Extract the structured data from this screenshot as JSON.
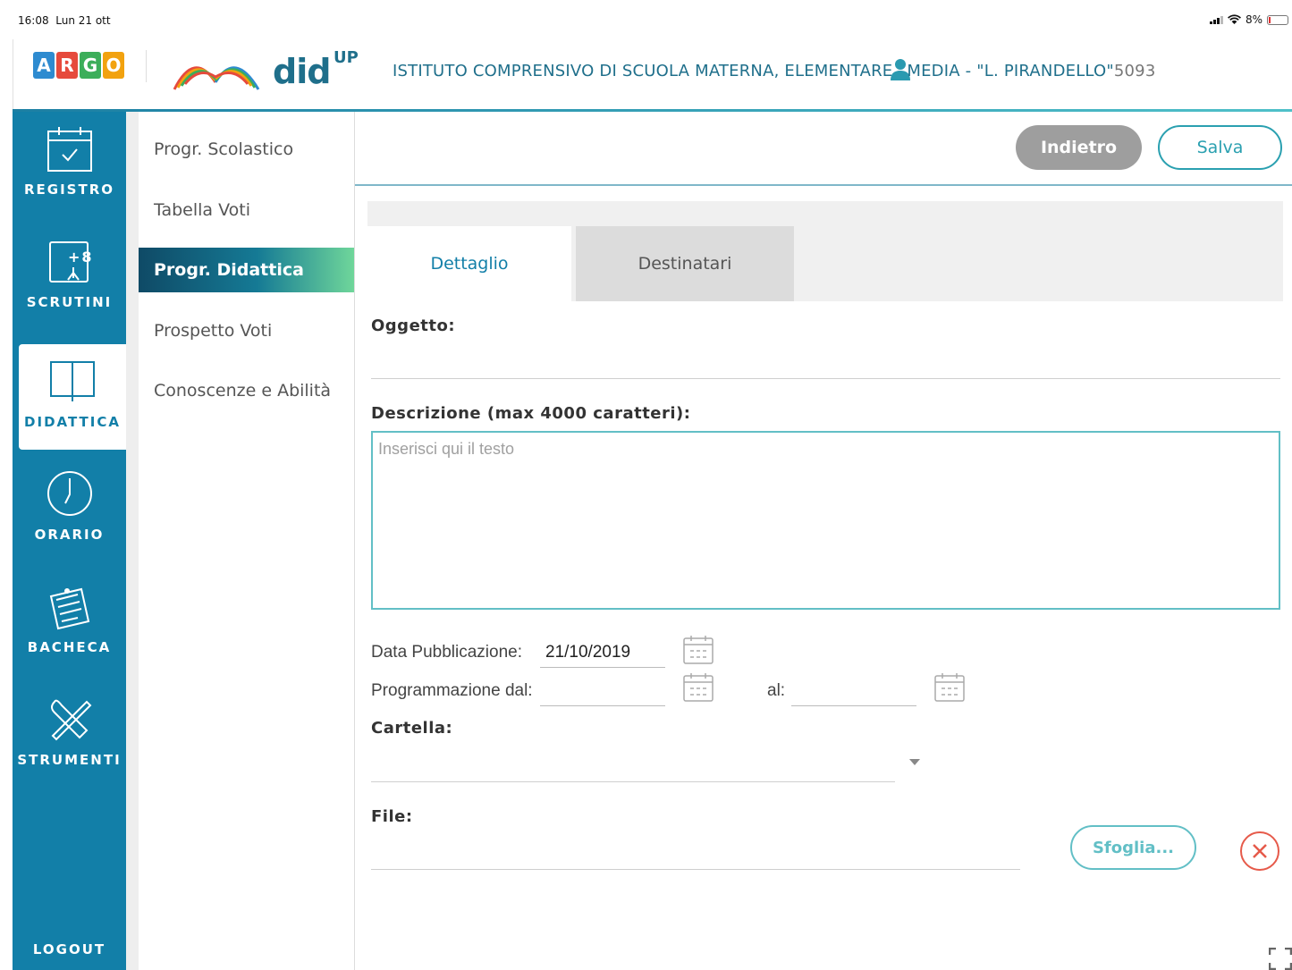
{
  "status": {
    "time": "16:08",
    "date": "Lun 21 ott",
    "battery": "8%"
  },
  "header": {
    "argo_letters": [
      "A",
      "R",
      "G",
      "O"
    ],
    "argo_colors": [
      "#2e8bd0",
      "#e64a3c",
      "#3cae5a",
      "#f2a20f"
    ],
    "app_name": "did",
    "app_sup": "UP",
    "school_before": "ISTITUTO COMPRENSIVO DI SCUOLA MATERNA, ELEMENTARE",
    "school_after": "MEDIA - \"L. PIRANDELLO\"",
    "school_code": "5093"
  },
  "nav": {
    "items": [
      {
        "label": "REGISTRO",
        "icon": "calendar-check-icon"
      },
      {
        "label": "SCRUTINI",
        "icon": "grade-board-icon"
      },
      {
        "label": "DIDATTICA",
        "icon": "open-book-icon",
        "active": true
      },
      {
        "label": "ORARIO",
        "icon": "clock-icon"
      },
      {
        "label": "BACHECA",
        "icon": "notice-board-icon"
      },
      {
        "label": "STRUMENTI",
        "icon": "tools-icon"
      }
    ],
    "logout": "LOGOUT"
  },
  "submenu": {
    "items": [
      "Progr. Scolastico",
      "Tabella Voti",
      "Progr. Didattica",
      "Prospetto Voti",
      "Conoscenze e Abilità"
    ],
    "active_index": 2
  },
  "toolbar": {
    "back_label": "Indietro",
    "save_label": "Salva"
  },
  "tabs": {
    "detail": "Dettaglio",
    "recipients": "Destinatari"
  },
  "form": {
    "subject_label": "Oggetto:",
    "description_label": "Descrizione (max 4000 caratteri):",
    "description_placeholder": "Inserisci qui il testo",
    "publication_label": "Data Pubblicazione:",
    "publication_value": "21/10/2019",
    "schedule_from_label": "Programmazione dal:",
    "schedule_to_label": "al:",
    "folder_label": "Cartella:",
    "file_label": "File:",
    "browse_label": "Sfoglia..."
  },
  "colors": {
    "primary": "#127fa8",
    "accent": "#62bfc6",
    "clear": "#e65a4a"
  }
}
